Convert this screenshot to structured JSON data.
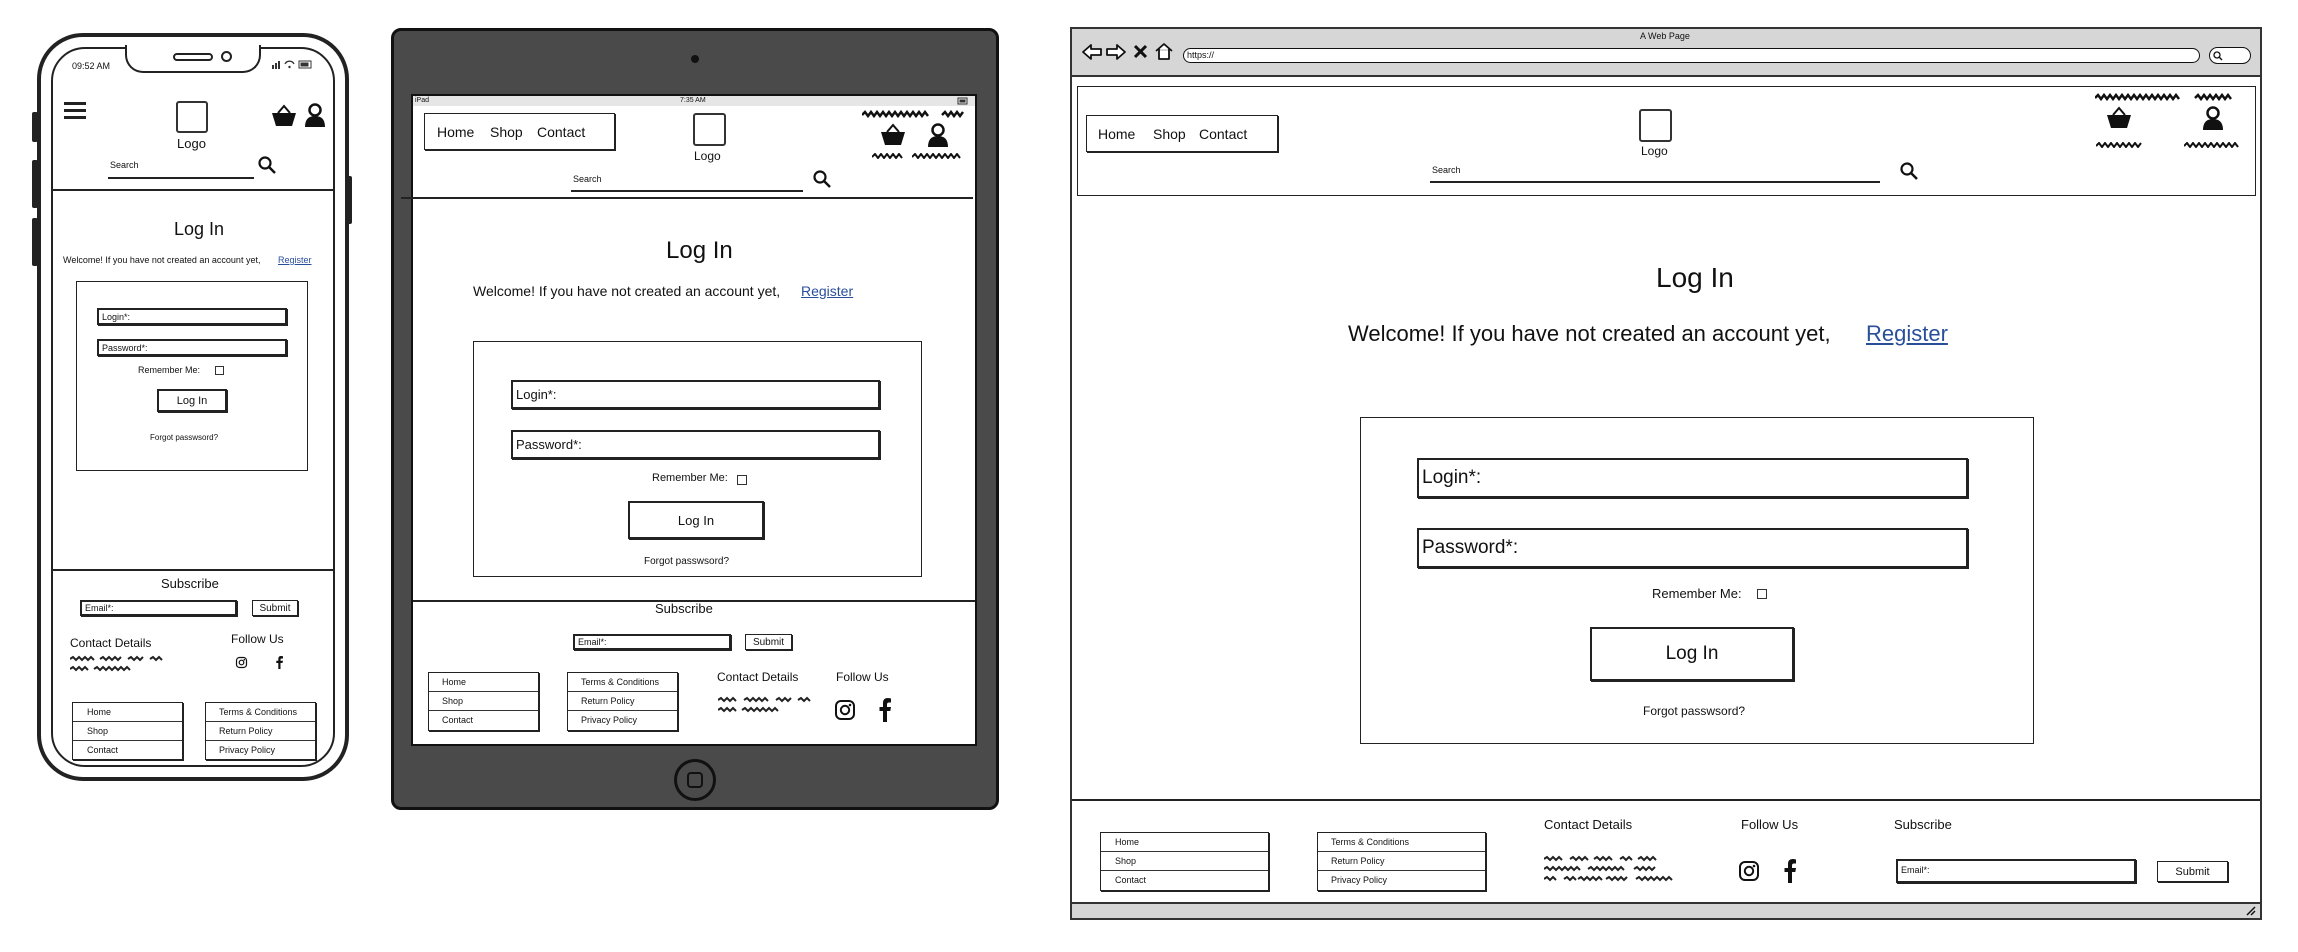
{
  "phone": {
    "status_time": "09:52 AM",
    "logo": "Logo",
    "search_placeholder": "Search",
    "login_title": "Log In",
    "welcome_text": "Welcome! If you have not created an account yet,",
    "register_link": "Register",
    "login_label": "Login*:",
    "password_label": "Password*:",
    "remember_label": "Remember Me:",
    "login_button": "Log In",
    "forgot_link": "Forgot passwsord?",
    "subscribe_title": "Subscribe",
    "email_label": "Email*:",
    "submit_button": "Submit",
    "contact_title": "Contact Details",
    "follow_title": "Follow Us",
    "nav_links": [
      "Home",
      "Shop",
      "Contact"
    ],
    "policy_links": [
      "Terms & Conditions",
      "Return Policy",
      "Privacy Policy"
    ]
  },
  "tablet": {
    "status_device": "iPad",
    "status_time": "7:35 AM",
    "nav_links": [
      "Home",
      "Shop",
      "Contact"
    ],
    "logo": "Logo",
    "search_placeholder": "Search",
    "login_title": "Log In",
    "welcome_text": "Welcome! If you have not created an account yet,",
    "register_link": "Register",
    "login_label": "Login*:",
    "password_label": "Password*:",
    "remember_label": "Remember Me:",
    "login_button": "Log In",
    "forgot_link": "Forgot passwsord?",
    "subscribe_title": "Subscribe",
    "email_label": "Email*:",
    "submit_button": "Submit",
    "footer_nav": [
      "Home",
      "Shop",
      "Contact"
    ],
    "policy_links": [
      "Terms & Conditions",
      "Return Policy",
      "Privacy Policy"
    ],
    "contact_title": "Contact Details",
    "follow_title": "Follow Us"
  },
  "browser": {
    "window_title": "A Web Page",
    "address": "https://",
    "nav_links": [
      "Home",
      "Shop",
      "Contact"
    ],
    "logo": "Logo",
    "search_placeholder": "Search",
    "login_title": "Log In",
    "welcome_text": "Welcome! If you have not created an account yet,",
    "register_link": "Register",
    "login_label": "Login*:",
    "password_label": "Password*:",
    "remember_label": "Remember Me:",
    "login_button": "Log In",
    "forgot_link": "Forgot passwsord?",
    "footer_nav": [
      "Home",
      "Shop",
      "Contact"
    ],
    "policy_links": [
      "Terms & Conditions",
      "Return Policy",
      "Privacy Policy"
    ],
    "contact_title": "Contact Details",
    "follow_title": "Follow Us",
    "subscribe_title": "Subscribe",
    "email_label": "Email*:",
    "submit_button": "Submit"
  },
  "colors": {
    "link": "#2a4f9a",
    "tablet_frame": "#4a4a4a",
    "browser_chrome": "#d6d6d6"
  }
}
